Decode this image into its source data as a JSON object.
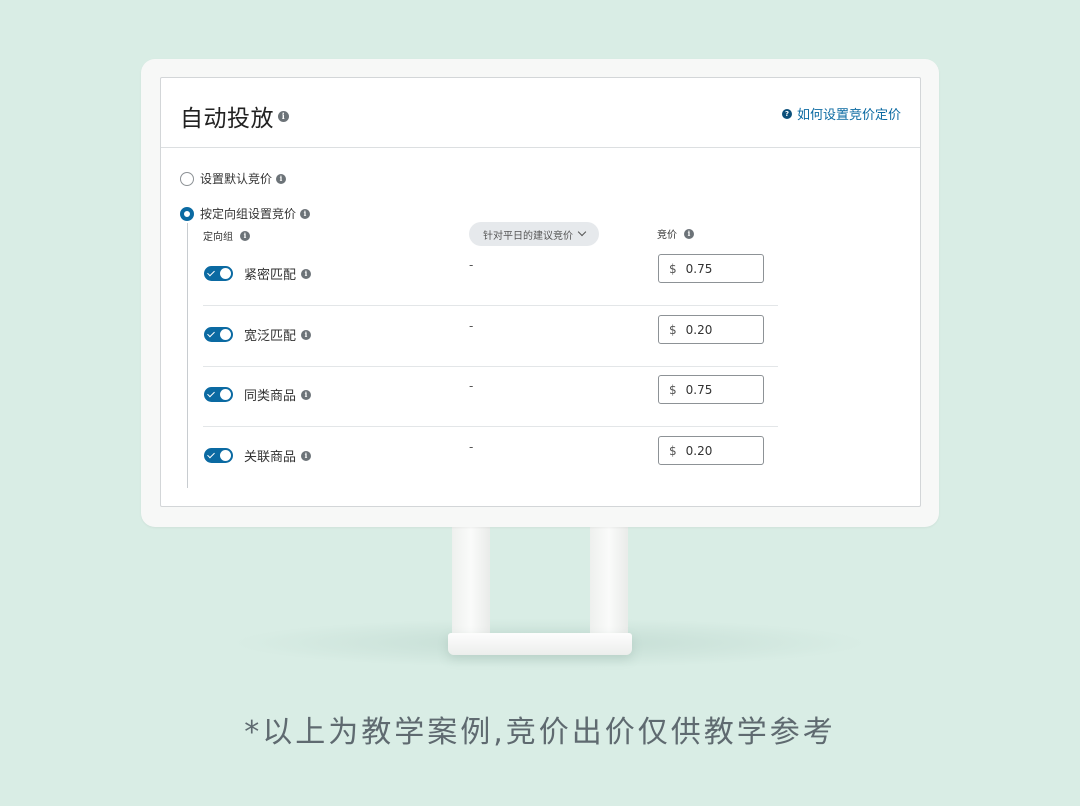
{
  "panel": {
    "title": "自动投放",
    "help_link": "如何设置竞价定价"
  },
  "options": {
    "default_bid": "设置默认竞价",
    "by_target_group": "按定向组设置竞价"
  },
  "columns": {
    "target_group": "定向组",
    "suggested_bid": "针对平日的建议竞价",
    "bid": "竞价"
  },
  "rows": [
    {
      "label": "紧密匹配",
      "suggested": "-",
      "currency": "$",
      "bid": "0.75",
      "enabled": true
    },
    {
      "label": "宽泛匹配",
      "suggested": "-",
      "currency": "$",
      "bid": "0.20",
      "enabled": true
    },
    {
      "label": "同类商品",
      "suggested": "-",
      "currency": "$",
      "bid": "0.75",
      "enabled": true
    },
    {
      "label": "关联商品",
      "suggested": "-",
      "currency": "$",
      "bid": "0.20",
      "enabled": true
    }
  ],
  "caption": "*以上为教学案例,竞价出价仅供教学参考",
  "colors": {
    "background": "#d9ede5",
    "accent": "#0b6aa2"
  }
}
